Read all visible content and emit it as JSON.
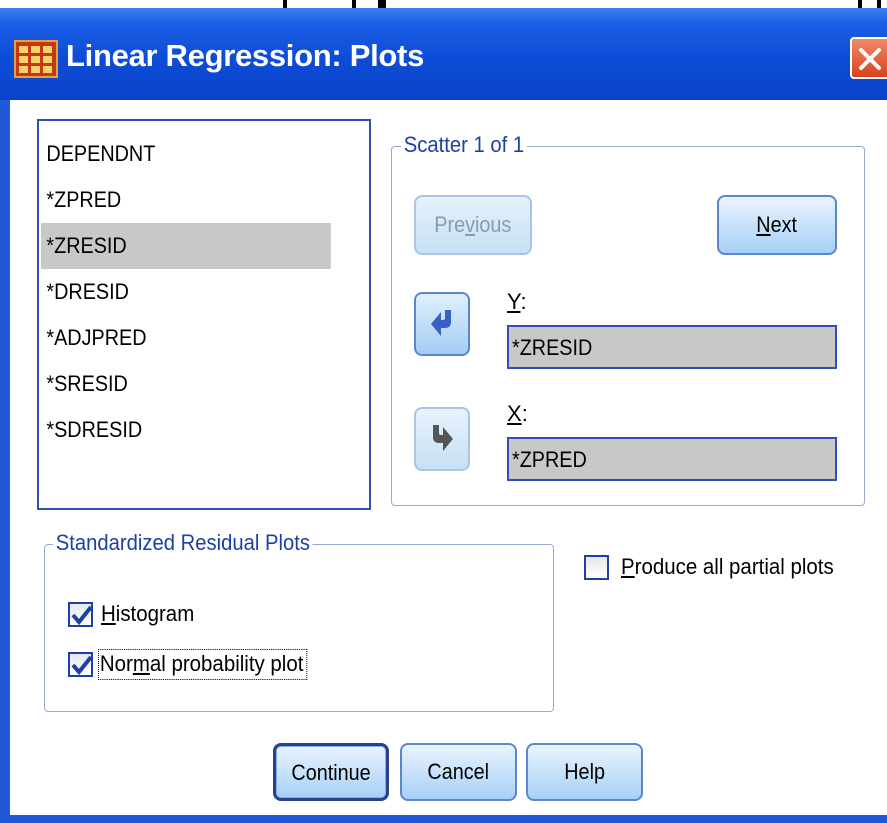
{
  "window": {
    "title": "Linear Regression: Plots",
    "icon": "spss-table-icon",
    "close_icon": "close-x-icon"
  },
  "variables": [
    {
      "label": "DEPENDNT",
      "selected": false
    },
    {
      "label": "*ZPRED",
      "selected": false
    },
    {
      "label": "*ZRESID",
      "selected": true
    },
    {
      "label": "*DRESID",
      "selected": false
    },
    {
      "label": "*ADJPRED",
      "selected": false
    },
    {
      "label": "*SRESID",
      "selected": false
    },
    {
      "label": "*SDRESID",
      "selected": false
    }
  ],
  "scatter": {
    "legend": "Scatter 1 of 1",
    "previous_label_pre": "Pre",
    "previous_label_ul": "v",
    "previous_label_post": "ious",
    "previous_enabled": false,
    "next_label_ul": "N",
    "next_label_post": "ext",
    "y_label_ul": "Y",
    "y_label_post": ":",
    "y_value": "*ZRESID",
    "x_label_ul": "X",
    "x_label_post": ":",
    "x_value": "*ZPRED"
  },
  "residual_plots": {
    "legend": "Standardized Residual Plots",
    "histogram_ul": "H",
    "histogram_post": "istogram",
    "histogram_checked": true,
    "normal_pre": "Nor",
    "normal_ul": "m",
    "normal_post": "al probability plot",
    "normal_checked": true
  },
  "partial_plots": {
    "label_ul": "P",
    "label_post": "roduce all partial plots",
    "checked": false
  },
  "buttons": {
    "continue": "Continue",
    "cancel": "Cancel",
    "help": "Help"
  },
  "colors": {
    "titlebar": "#0d4cd6",
    "selection": "#c8c8c8",
    "group_text": "#1c3fa8",
    "check_mark": "#1c3fa8"
  }
}
